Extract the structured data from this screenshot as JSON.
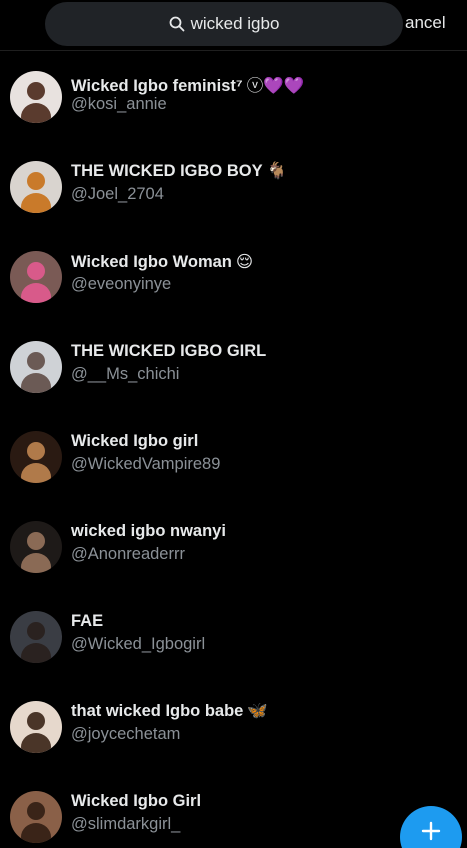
{
  "search": {
    "query": "wicked igbo",
    "cancel_label": "ancel"
  },
  "results": [
    {
      "name": "Wicked Igbo feminist⁷",
      "emoji": "ⓥ💜💜",
      "handle": "@kosi_annie",
      "avatar_bg": "#e8e2df",
      "avatar_fg": "#5a3b2e"
    },
    {
      "name": "THE WICKED IGBO BOY",
      "emoji": "🐐",
      "handle": "@Joel_2704",
      "avatar_bg": "#d9d4cf",
      "avatar_fg": "#c97a2a"
    },
    {
      "name": "Wicked Igbo Woman",
      "emoji": "😌",
      "handle": "@eveonyinye",
      "avatar_bg": "#7a5a55",
      "avatar_fg": "#d85a8a"
    },
    {
      "name": "THE WICKED IGBO GIRL",
      "emoji": "",
      "handle": "@__Ms_chichi",
      "avatar_bg": "#cfd2d6",
      "avatar_fg": "#6b5a55"
    },
    {
      "name": "Wicked Igbo girl",
      "emoji": "",
      "handle": "@WickedVampire89",
      "avatar_bg": "#2a1a12",
      "avatar_fg": "#b07a4a"
    },
    {
      "name": "wicked igbo nwanyi",
      "emoji": "",
      "handle": "@Anonreaderrr",
      "avatar_bg": "#1e1a18",
      "avatar_fg": "#8a6a55"
    },
    {
      "name": "FAE",
      "emoji": "",
      "handle": "@Wicked_Igbogirl",
      "avatar_bg": "#3a3d44",
      "avatar_fg": "#2a2220"
    },
    {
      "name": "that wicked Igbo babe",
      "emoji": "🦋",
      "handle": "@joycechetam",
      "avatar_bg": "#e6d8cc",
      "avatar_fg": "#4a3528"
    },
    {
      "name": "Wicked Igbo Girl",
      "emoji": "",
      "handle": "@slimdarkgirl_",
      "avatar_bg": "#8a6048",
      "avatar_fg": "#3a2418"
    }
  ],
  "colors": {
    "background": "#000000",
    "accent": "#1d9bf0",
    "search_bg": "#202327",
    "secondary_text": "#8b9197"
  },
  "icons": {
    "search": "search-icon",
    "fab": "plus-icon"
  }
}
